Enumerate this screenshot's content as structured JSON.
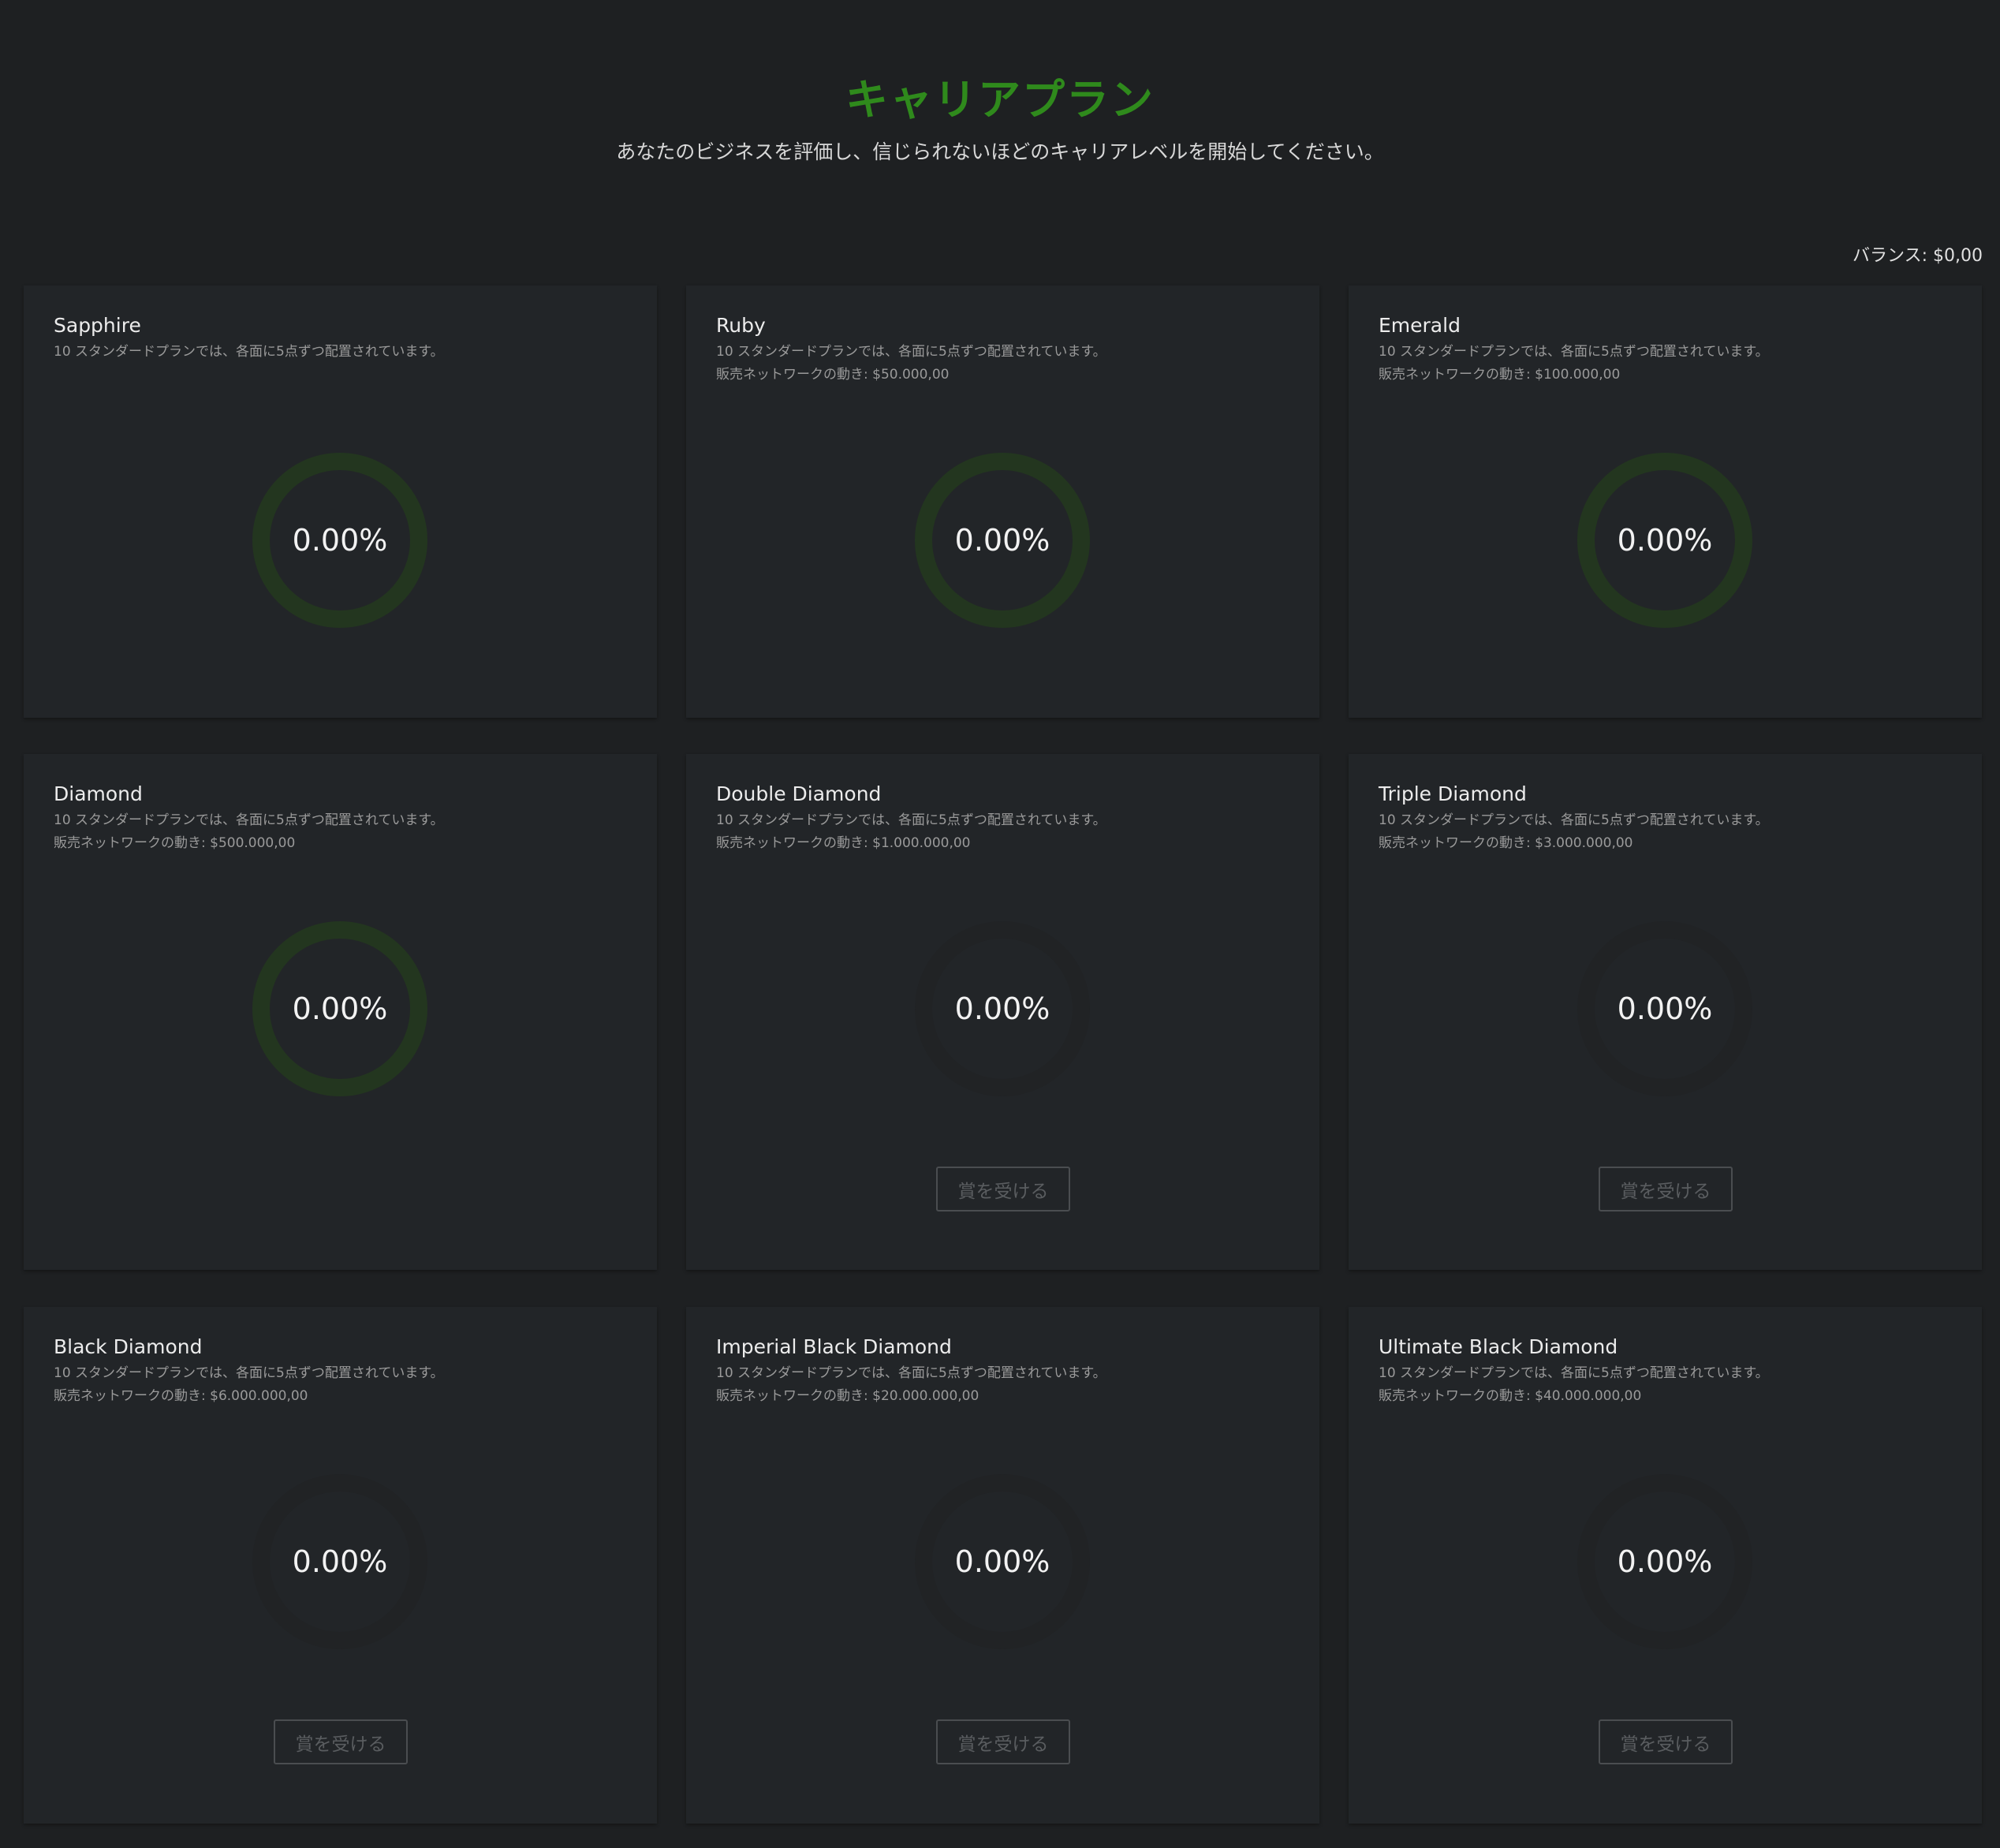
{
  "header": {
    "title": "キャリアプラン",
    "subtitle": "あなたのビジネスを評価し、信じられないほどのキャリアレベルを開始してください。"
  },
  "balance": {
    "label": "バランス: $0,00"
  },
  "colors": {
    "title_green": "#2f8a1c",
    "ring_active": "#23361f",
    "ring_inactive": "#212325",
    "card_bg": "#222528",
    "page_bg": "#1e2022"
  },
  "claim_label": "賞を受ける",
  "plans": [
    {
      "name": "Sapphire",
      "desc": "10 スタンダードプランでは、各面に5点ずつ配置されています。",
      "network": "",
      "progress": "0.00%",
      "progress_fraction": 0,
      "active": true,
      "claim": false
    },
    {
      "name": "Ruby",
      "desc": "10 スタンダードプランでは、各面に5点ずつ配置されています。",
      "network": "販売ネットワークの動き: $50.000,00",
      "progress": "0.00%",
      "progress_fraction": 0,
      "active": true,
      "claim": false
    },
    {
      "name": "Emerald",
      "desc": "10 スタンダードプランでは、各面に5点ずつ配置されています。",
      "network": "販売ネットワークの動き: $100.000,00",
      "progress": "0.00%",
      "progress_fraction": 0,
      "active": true,
      "claim": false
    },
    {
      "name": "Diamond",
      "desc": "10 スタンダードプランでは、各面に5点ずつ配置されています。",
      "network": "販売ネットワークの動き: $500.000,00",
      "progress": "0.00%",
      "progress_fraction": 0,
      "active": true,
      "claim": false
    },
    {
      "name": "Double Diamond",
      "desc": "10 スタンダードプランでは、各面に5点ずつ配置されています。",
      "network": "販売ネットワークの動き: $1.000.000,00",
      "progress": "0.00%",
      "progress_fraction": 0,
      "active": false,
      "claim": true
    },
    {
      "name": "Triple Diamond",
      "desc": "10 スタンダードプランでは、各面に5点ずつ配置されています。",
      "network": "販売ネットワークの動き: $3.000.000,00",
      "progress": "0.00%",
      "progress_fraction": 0,
      "active": false,
      "claim": true
    },
    {
      "name": "Black Diamond",
      "desc": "10 スタンダードプランでは、各面に5点ずつ配置されています。",
      "network": "販売ネットワークの動き: $6.000.000,00",
      "progress": "0.00%",
      "progress_fraction": 0,
      "active": false,
      "claim": true
    },
    {
      "name": "Imperial Black Diamond",
      "desc": "10 スタンダードプランでは、各面に5点ずつ配置されています。",
      "network": "販売ネットワークの動き: $20.000.000,00",
      "progress": "0.00%",
      "progress_fraction": 0,
      "active": false,
      "claim": true
    },
    {
      "name": "Ultimate Black Diamond",
      "desc": "10 スタンダードプランでは、各面に5点ずつ配置されています。",
      "network": "販売ネットワークの動き: $40.000.000,00",
      "progress": "0.00%",
      "progress_fraction": 0,
      "active": false,
      "claim": true
    }
  ]
}
